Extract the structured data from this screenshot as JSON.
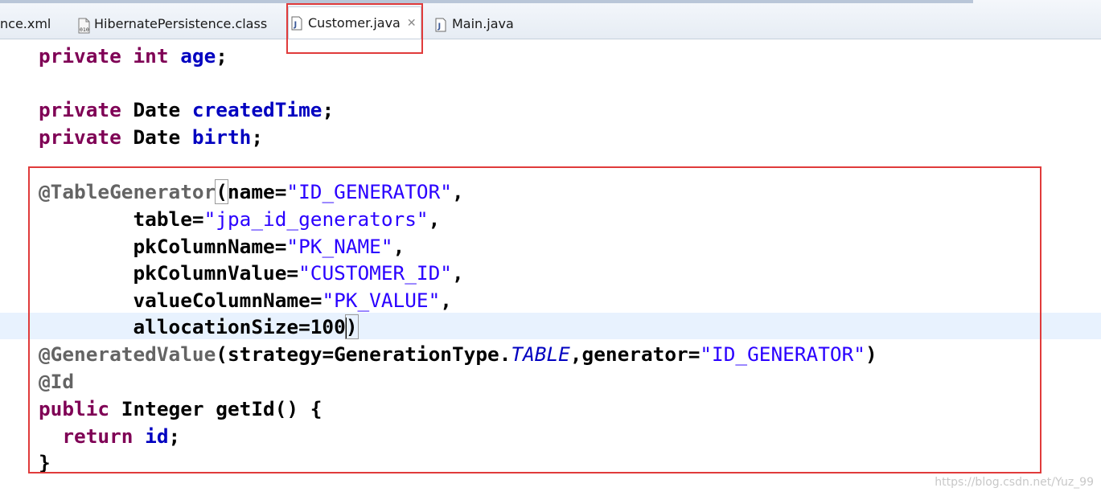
{
  "tabs": [
    {
      "label": "nce.xml",
      "icon": "xml-file-icon",
      "active": false
    },
    {
      "label": "HibernatePersistence.class",
      "icon": "class-file-icon",
      "active": false
    },
    {
      "label": "Customer.java",
      "icon": "java-file-icon",
      "active": true,
      "close": "✕"
    },
    {
      "label": "Main.java",
      "icon": "java-file-icon",
      "active": false
    }
  ],
  "code": {
    "line1": {
      "kw": "private",
      "type": "int",
      "name": "age",
      "end": ";"
    },
    "line2": {
      "kw": "private",
      "type": "Date",
      "name": "createdTime",
      "end": ";"
    },
    "line3": {
      "kw": "private",
      "type": "Date",
      "name": "birth",
      "end": ";"
    },
    "line4": {
      "ann": "@TableGenerator",
      "open": "(",
      "attr": "name=",
      "val": "\"ID_GENERATOR\"",
      "end": ","
    },
    "line5": {
      "attr": "table=",
      "val": "\"jpa_id_generators\"",
      "end": ","
    },
    "line6": {
      "attr": "pkColumnName=",
      "val": "\"PK_NAME\"",
      "end": ","
    },
    "line7": {
      "attr": "pkColumnValue=",
      "val": "\"CUSTOMER_ID\"",
      "end": ","
    },
    "line8": {
      "attr": "valueColumnName=",
      "val": "\"PK_VALUE\"",
      "end": ","
    },
    "line9": {
      "attr": "allocationSize=100",
      "close": ")"
    },
    "line10": {
      "ann": "@GeneratedValue",
      "pre": "(strategy=GenerationType.",
      "stat": "TABLE",
      "mid": ",generator=",
      "val": "\"ID_GENERATOR\"",
      "end": ")"
    },
    "line11": {
      "ann": "@Id"
    },
    "line12": {
      "kw": "public",
      "rest": " Integer getId() {"
    },
    "line13": {
      "kw": "return",
      "name": "id",
      "end": ";"
    },
    "line14": {
      "text": "}"
    }
  },
  "watermark": "https://blog.csdn.net/Yuz_99",
  "colors": {
    "keyword": "#7f0055",
    "field": "#0000c0",
    "string": "#2a00ff",
    "annotation": "#646464",
    "highlight": "#e03b3b",
    "current_line": "#e8f2fe"
  }
}
